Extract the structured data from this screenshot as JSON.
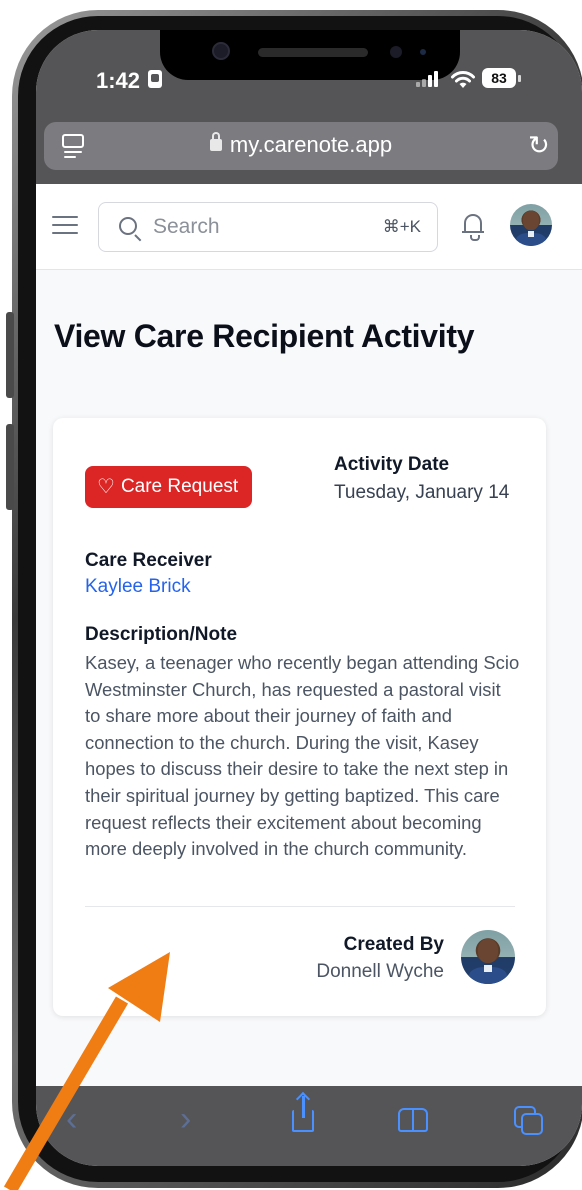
{
  "status_bar": {
    "time": "1:42",
    "battery": "83"
  },
  "browser": {
    "url": "my.carenote.app"
  },
  "header": {
    "search_placeholder": "Search",
    "shortcut": "⌘+K"
  },
  "page": {
    "title": "View Care Recipient Activity"
  },
  "activity": {
    "badge": "Care Request",
    "date_label": "Activity Date",
    "date_value": "Tuesday, January 14",
    "receiver_label": "Care Receiver",
    "receiver_name": "Kaylee Brick",
    "description_label": "Description/Note",
    "description": "Kasey, a teenager who recently began attending Scio Westminster Church, has requested a pastoral visit to share more about their journey of faith and connection to the church. During the visit, Kasey hopes to discuss their desire to take the next step in their spiritual journey by getting baptized. This care request reflects their excitement about becoming more deeply involved in the church community.",
    "created_by_label": "Created By",
    "created_by_name": "Donnell Wyche"
  },
  "icons": {
    "heart": "♡",
    "back": "‹",
    "forward": "›",
    "wifi": "wifi-icon",
    "reload": "↻"
  },
  "colors": {
    "badge": "#dc2626",
    "link": "#2563eb",
    "arrow": "#f07c14",
    "browser_chrome": "#555557"
  }
}
